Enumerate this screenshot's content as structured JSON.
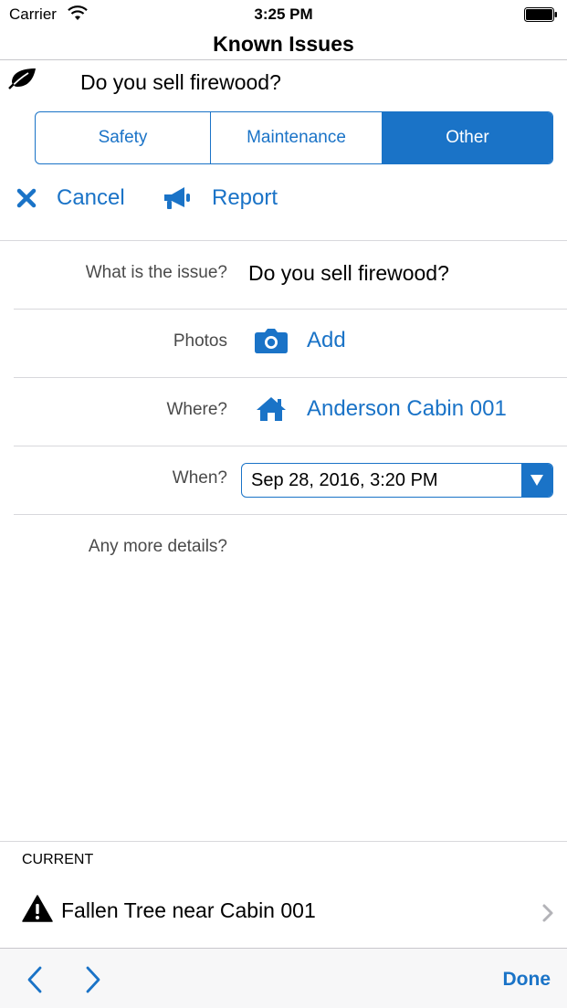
{
  "status_bar": {
    "carrier": "Carrier",
    "time": "3:25 PM"
  },
  "nav": {
    "title": "Known Issues"
  },
  "issue": {
    "title": "Do you sell firewood?",
    "icon": "leaf-icon"
  },
  "segments": [
    {
      "label": "Safety",
      "selected": false
    },
    {
      "label": "Maintenance",
      "selected": false
    },
    {
      "label": "Other",
      "selected": true
    }
  ],
  "actions": {
    "cancel_label": "Cancel",
    "report_label": "Report"
  },
  "form": {
    "issue_label": "What is the issue?",
    "issue_value": "Do you sell firewood?",
    "photos_label": "Photos",
    "photos_action": "Add",
    "where_label": "Where?",
    "where_value": "Anderson Cabin 001",
    "when_label": "When?",
    "when_value": "Sep 28, 2016, 3:20 PM",
    "details_label": "Any more details?"
  },
  "current": {
    "header": "CURRENT",
    "item_label": "Fallen Tree near Cabin 001",
    "item_icon": "warning-icon"
  },
  "toolbar": {
    "done_label": "Done"
  },
  "colors": {
    "accent": "#1a73c7",
    "divider": "#d8d8dc",
    "toolbar_bg": "#f7f7f8"
  }
}
